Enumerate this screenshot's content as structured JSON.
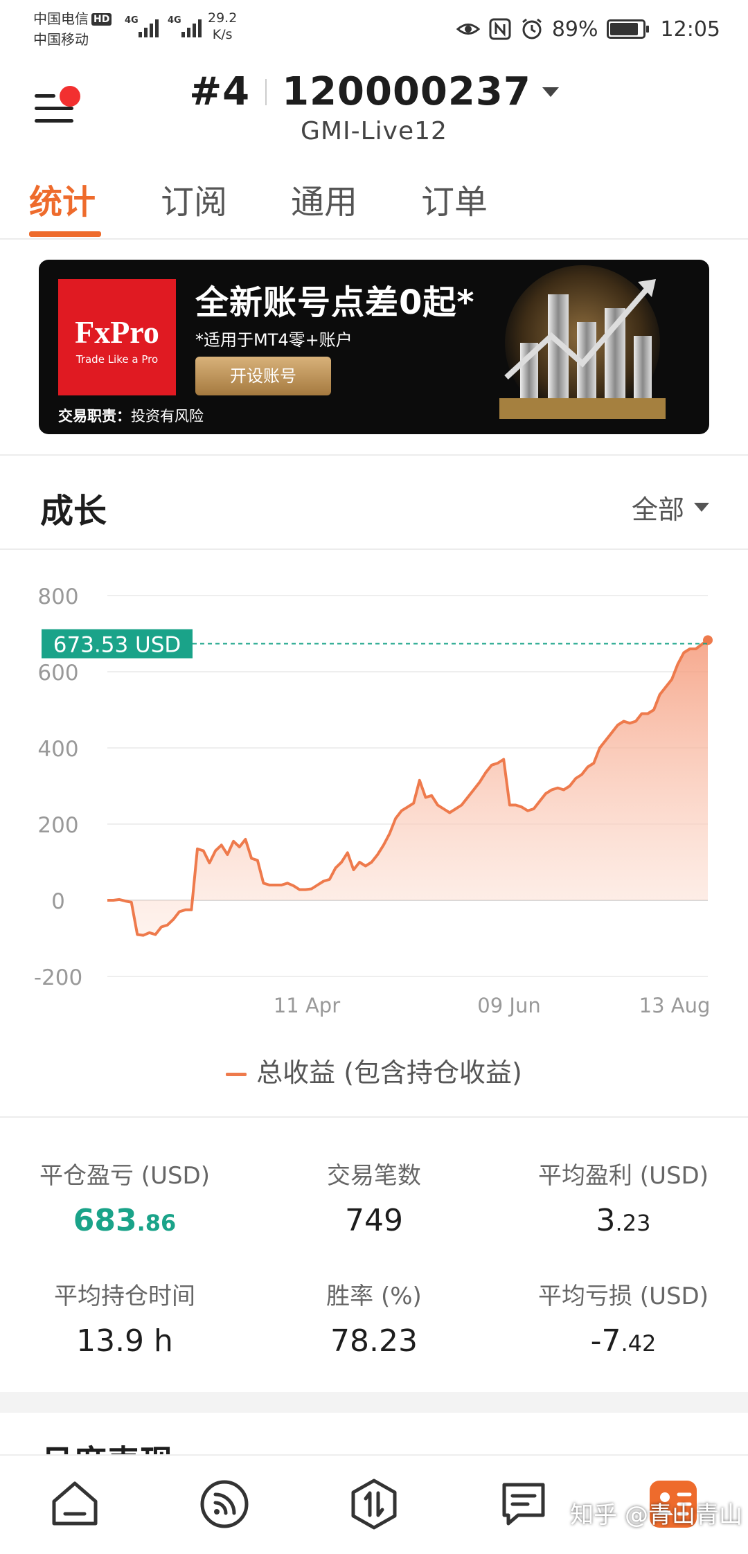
{
  "status_bar": {
    "carrier1": "中国电信",
    "hd": "HD",
    "carrier2": "中国移动",
    "net1": "4G",
    "net2": "4G",
    "speed_value": "29.2",
    "speed_unit": "K/s",
    "battery_percent": "89%",
    "battery_level": 0.89,
    "time": "12:05"
  },
  "header": {
    "account_index": "#4",
    "account_number": "120000237",
    "server": "GMI-Live12"
  },
  "tabs": [
    {
      "label": "统计",
      "active": true
    },
    {
      "label": "订阅",
      "active": false
    },
    {
      "label": "通用",
      "active": false
    },
    {
      "label": "订单",
      "active": false
    }
  ],
  "banner": {
    "logo_text": "FxPro",
    "logo_tagline": "Trade Like a Pro",
    "title": "全新账号点差0起*",
    "subtitle": "*适用于MT4零+账户",
    "button": "开设账号",
    "risk_label": "交易职责：",
    "risk_text": "投资有风险"
  },
  "growth": {
    "title": "成长",
    "filter": "全部"
  },
  "chart_data": {
    "type": "area",
    "title": "",
    "xlabel": "",
    "ylabel": "",
    "ylim": [
      -200,
      800
    ],
    "yticks": [
      800,
      600,
      400,
      200,
      0,
      -200
    ],
    "xtick_labels": [
      "11 Apr",
      "09 Jun",
      "13 Aug"
    ],
    "current_value_label": "673.53 USD",
    "current_value": 673.53,
    "series": [
      {
        "name": "总收益 (包含持仓收益)",
        "color": "#ee7a4c",
        "values": [
          0,
          0,
          2,
          -2,
          -5,
          -90,
          -92,
          -85,
          -90,
          -70,
          -65,
          -50,
          -30,
          -25,
          -25,
          135,
          130,
          98,
          130,
          145,
          120,
          155,
          140,
          160,
          110,
          105,
          45,
          40,
          40,
          40,
          45,
          38,
          28,
          28,
          30,
          40,
          50,
          55,
          85,
          100,
          125,
          80,
          100,
          90,
          100,
          120,
          145,
          175,
          215,
          235,
          245,
          255,
          315,
          270,
          275,
          250,
          240,
          230,
          240,
          250,
          270,
          290,
          310,
          335,
          355,
          360,
          370,
          250,
          250,
          245,
          235,
          240,
          260,
          280,
          290,
          295,
          290,
          300,
          320,
          330,
          350,
          360,
          400,
          420,
          440,
          460,
          470,
          465,
          470,
          490,
          490,
          500,
          540,
          560,
          580,
          620,
          650,
          660,
          660,
          672,
          683
        ]
      }
    ]
  },
  "stats": {
    "closed_pnl_label": "平仓盈亏 (USD)",
    "closed_pnl_int": "683",
    "closed_pnl_dec": ".86",
    "trades_label": "交易笔数",
    "trades": "749",
    "avg_profit_label": "平均盈利 (USD)",
    "avg_profit_int": "3",
    "avg_profit_dec": ".23",
    "avg_hold_label": "平均持仓时间",
    "avg_hold": "13.9 h",
    "win_rate_label": "胜率 (%)",
    "win_rate": "78.23",
    "avg_loss_label": "平均亏损 (USD)",
    "avg_loss_int": "-7",
    "avg_loss_dec": ".42"
  },
  "next_section": "月度表现",
  "bottom_nav": [
    {
      "icon": "home-icon"
    },
    {
      "icon": "signal-icon"
    },
    {
      "icon": "trade-icon"
    },
    {
      "icon": "news-icon"
    },
    {
      "icon": "mine-icon"
    }
  ],
  "watermark": "知乎 @青山青山"
}
